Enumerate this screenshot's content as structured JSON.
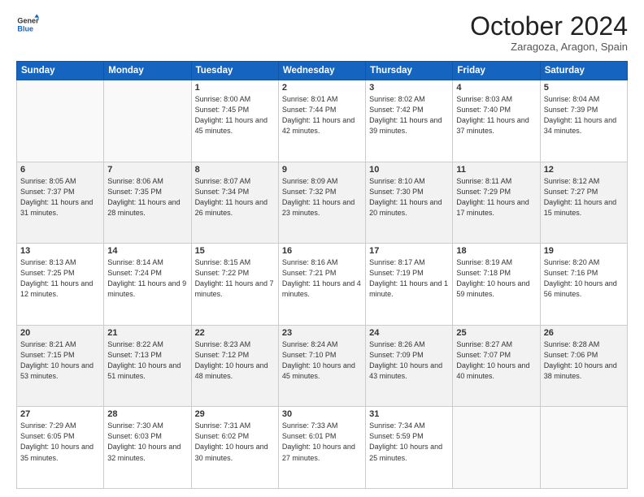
{
  "logo": {
    "line1": "General",
    "line2": "Blue"
  },
  "title": "October 2024",
  "location": "Zaragoza, Aragon, Spain",
  "days_of_week": [
    "Sunday",
    "Monday",
    "Tuesday",
    "Wednesday",
    "Thursday",
    "Friday",
    "Saturday"
  ],
  "weeks": [
    [
      {
        "day": "",
        "info": ""
      },
      {
        "day": "",
        "info": ""
      },
      {
        "day": "1",
        "info": "Sunrise: 8:00 AM\nSunset: 7:45 PM\nDaylight: 11 hours and 45 minutes."
      },
      {
        "day": "2",
        "info": "Sunrise: 8:01 AM\nSunset: 7:44 PM\nDaylight: 11 hours and 42 minutes."
      },
      {
        "day": "3",
        "info": "Sunrise: 8:02 AM\nSunset: 7:42 PM\nDaylight: 11 hours and 39 minutes."
      },
      {
        "day": "4",
        "info": "Sunrise: 8:03 AM\nSunset: 7:40 PM\nDaylight: 11 hours and 37 minutes."
      },
      {
        "day": "5",
        "info": "Sunrise: 8:04 AM\nSunset: 7:39 PM\nDaylight: 11 hours and 34 minutes."
      }
    ],
    [
      {
        "day": "6",
        "info": "Sunrise: 8:05 AM\nSunset: 7:37 PM\nDaylight: 11 hours and 31 minutes."
      },
      {
        "day": "7",
        "info": "Sunrise: 8:06 AM\nSunset: 7:35 PM\nDaylight: 11 hours and 28 minutes."
      },
      {
        "day": "8",
        "info": "Sunrise: 8:07 AM\nSunset: 7:34 PM\nDaylight: 11 hours and 26 minutes."
      },
      {
        "day": "9",
        "info": "Sunrise: 8:09 AM\nSunset: 7:32 PM\nDaylight: 11 hours and 23 minutes."
      },
      {
        "day": "10",
        "info": "Sunrise: 8:10 AM\nSunset: 7:30 PM\nDaylight: 11 hours and 20 minutes."
      },
      {
        "day": "11",
        "info": "Sunrise: 8:11 AM\nSunset: 7:29 PM\nDaylight: 11 hours and 17 minutes."
      },
      {
        "day": "12",
        "info": "Sunrise: 8:12 AM\nSunset: 7:27 PM\nDaylight: 11 hours and 15 minutes."
      }
    ],
    [
      {
        "day": "13",
        "info": "Sunrise: 8:13 AM\nSunset: 7:25 PM\nDaylight: 11 hours and 12 minutes."
      },
      {
        "day": "14",
        "info": "Sunrise: 8:14 AM\nSunset: 7:24 PM\nDaylight: 11 hours and 9 minutes."
      },
      {
        "day": "15",
        "info": "Sunrise: 8:15 AM\nSunset: 7:22 PM\nDaylight: 11 hours and 7 minutes."
      },
      {
        "day": "16",
        "info": "Sunrise: 8:16 AM\nSunset: 7:21 PM\nDaylight: 11 hours and 4 minutes."
      },
      {
        "day": "17",
        "info": "Sunrise: 8:17 AM\nSunset: 7:19 PM\nDaylight: 11 hours and 1 minute."
      },
      {
        "day": "18",
        "info": "Sunrise: 8:19 AM\nSunset: 7:18 PM\nDaylight: 10 hours and 59 minutes."
      },
      {
        "day": "19",
        "info": "Sunrise: 8:20 AM\nSunset: 7:16 PM\nDaylight: 10 hours and 56 minutes."
      }
    ],
    [
      {
        "day": "20",
        "info": "Sunrise: 8:21 AM\nSunset: 7:15 PM\nDaylight: 10 hours and 53 minutes."
      },
      {
        "day": "21",
        "info": "Sunrise: 8:22 AM\nSunset: 7:13 PM\nDaylight: 10 hours and 51 minutes."
      },
      {
        "day": "22",
        "info": "Sunrise: 8:23 AM\nSunset: 7:12 PM\nDaylight: 10 hours and 48 minutes."
      },
      {
        "day": "23",
        "info": "Sunrise: 8:24 AM\nSunset: 7:10 PM\nDaylight: 10 hours and 45 minutes."
      },
      {
        "day": "24",
        "info": "Sunrise: 8:26 AM\nSunset: 7:09 PM\nDaylight: 10 hours and 43 minutes."
      },
      {
        "day": "25",
        "info": "Sunrise: 8:27 AM\nSunset: 7:07 PM\nDaylight: 10 hours and 40 minutes."
      },
      {
        "day": "26",
        "info": "Sunrise: 8:28 AM\nSunset: 7:06 PM\nDaylight: 10 hours and 38 minutes."
      }
    ],
    [
      {
        "day": "27",
        "info": "Sunrise: 7:29 AM\nSunset: 6:05 PM\nDaylight: 10 hours and 35 minutes."
      },
      {
        "day": "28",
        "info": "Sunrise: 7:30 AM\nSunset: 6:03 PM\nDaylight: 10 hours and 32 minutes."
      },
      {
        "day": "29",
        "info": "Sunrise: 7:31 AM\nSunset: 6:02 PM\nDaylight: 10 hours and 30 minutes."
      },
      {
        "day": "30",
        "info": "Sunrise: 7:33 AM\nSunset: 6:01 PM\nDaylight: 10 hours and 27 minutes."
      },
      {
        "day": "31",
        "info": "Sunrise: 7:34 AM\nSunset: 5:59 PM\nDaylight: 10 hours and 25 minutes."
      },
      {
        "day": "",
        "info": ""
      },
      {
        "day": "",
        "info": ""
      }
    ]
  ]
}
